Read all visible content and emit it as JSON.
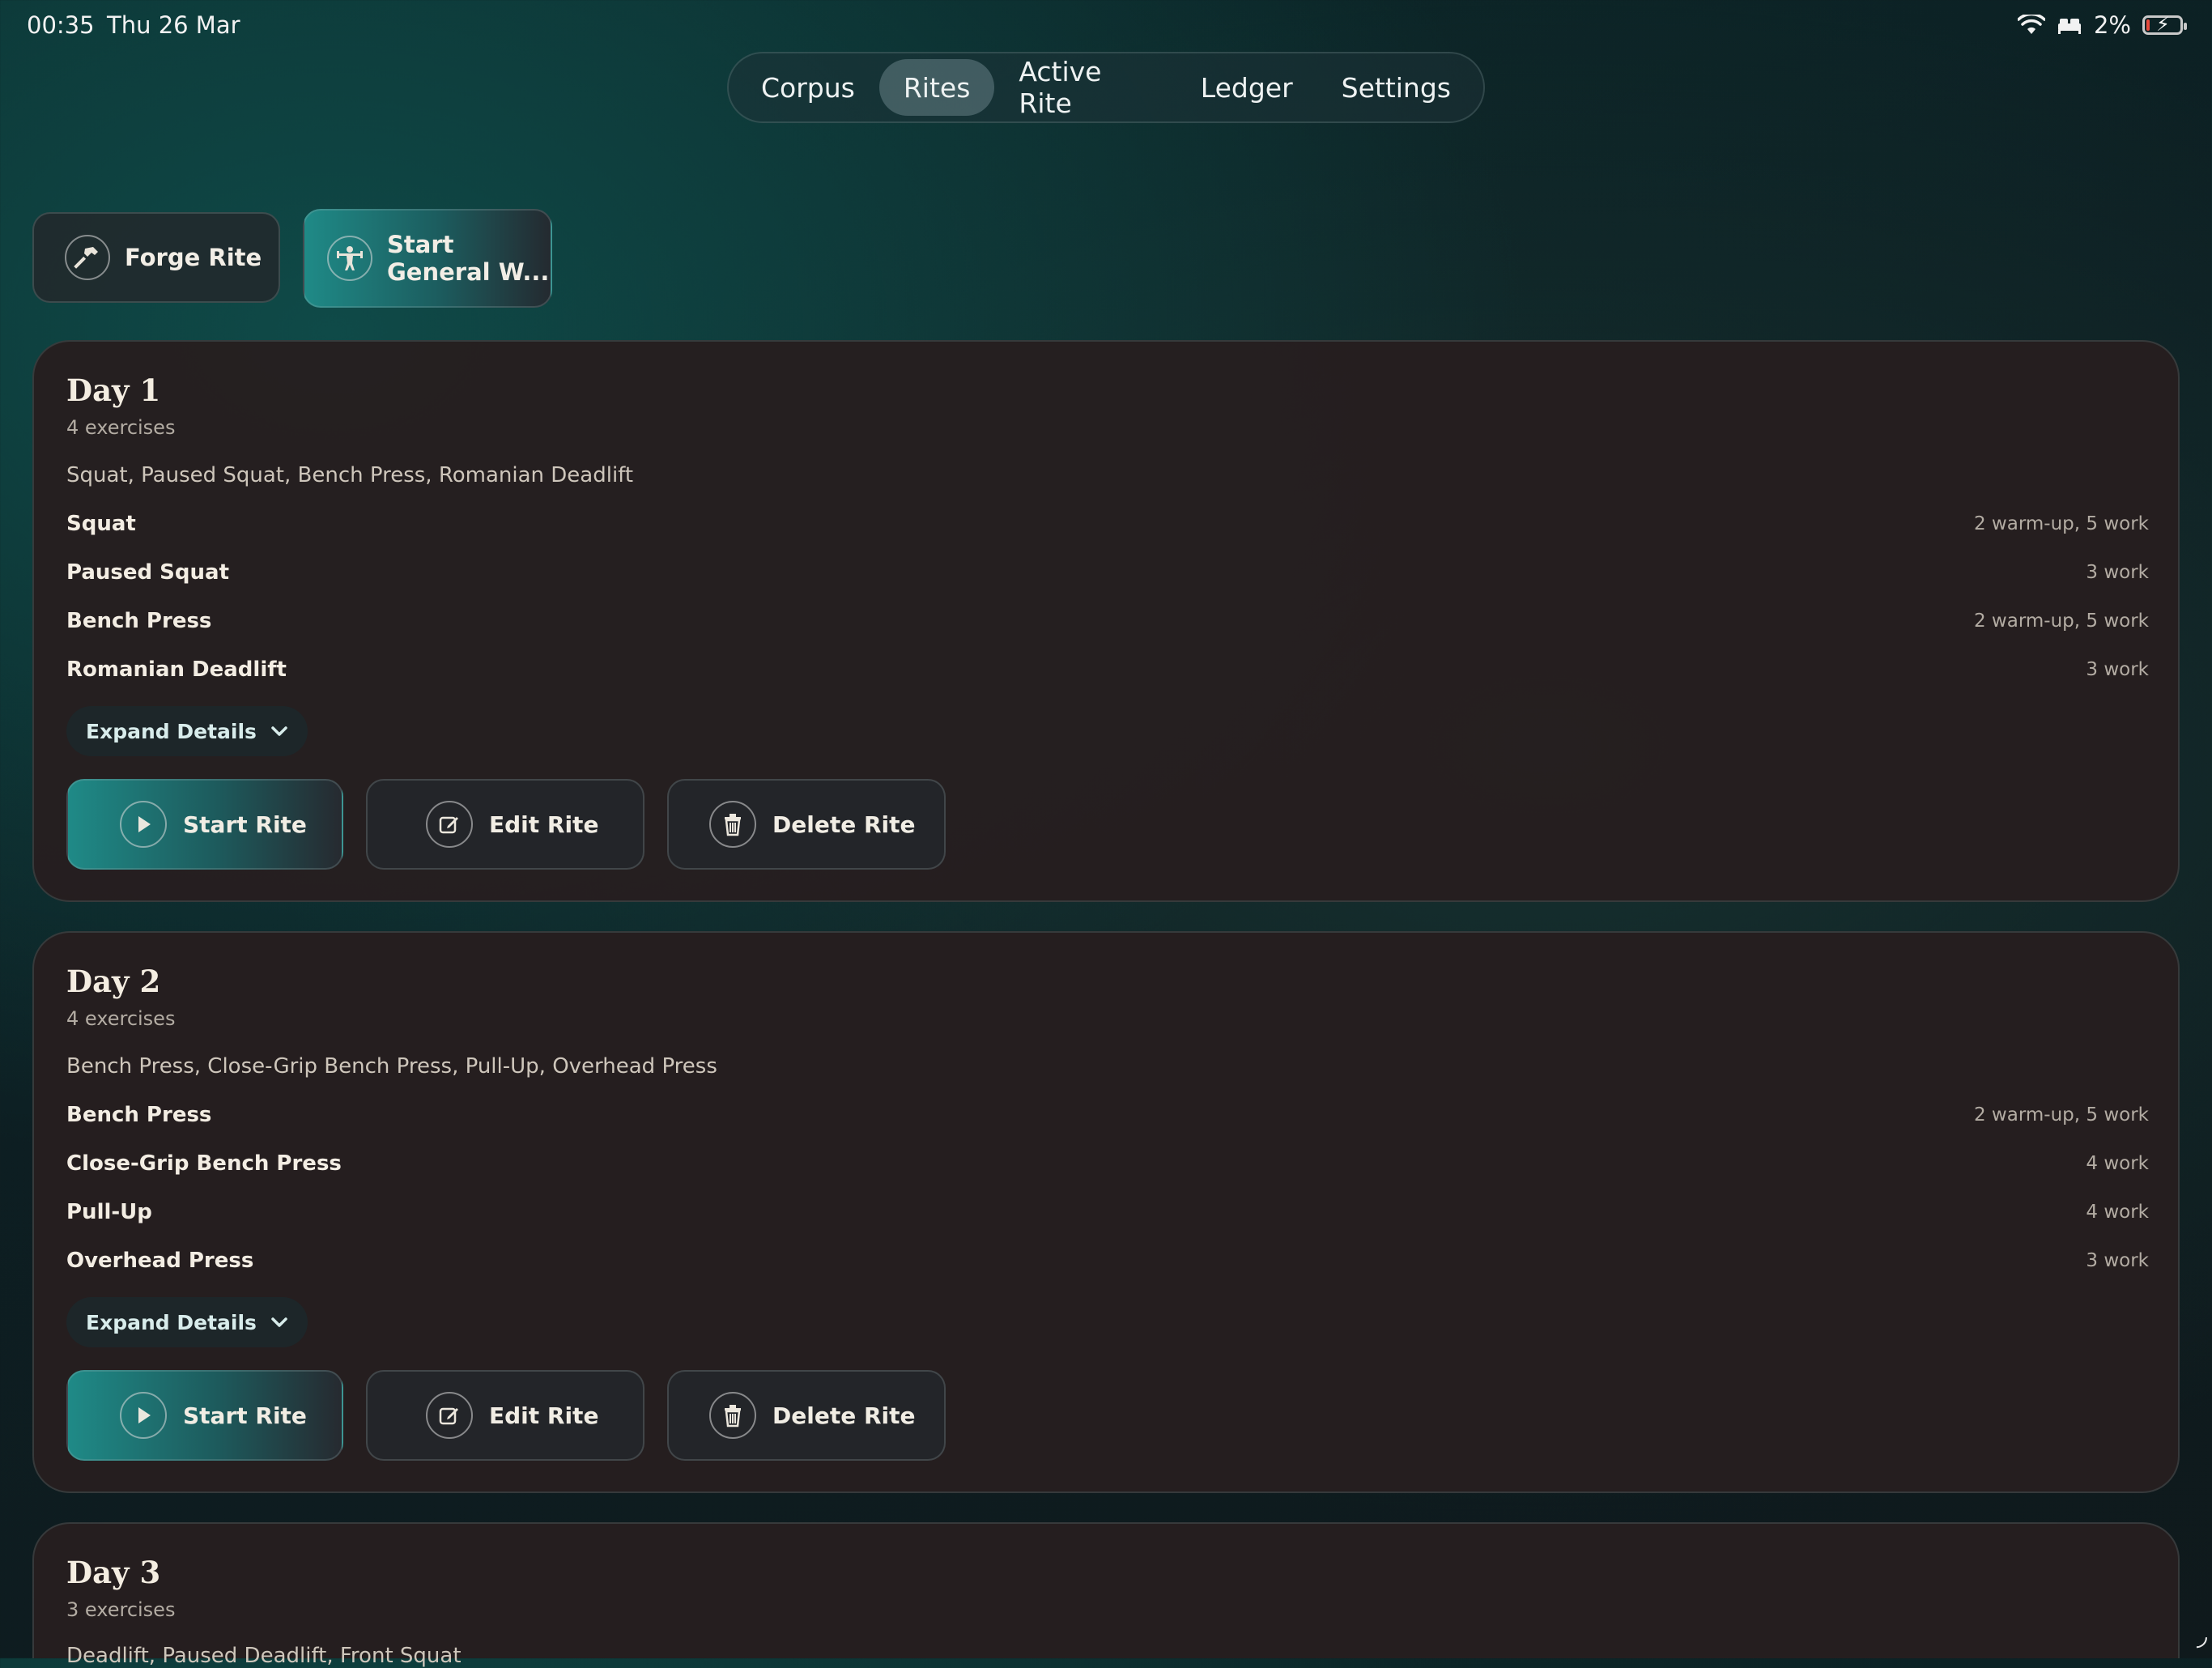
{
  "status_bar": {
    "time": "00:35",
    "date": "Thu 26 Mar",
    "battery": "2%",
    "icons": [
      "wifi-icon",
      "bed-icon",
      "battery-charging-icon"
    ]
  },
  "nav": {
    "tabs": [
      {
        "label": "Corpus",
        "active": false
      },
      {
        "label": "Rites",
        "active": true
      },
      {
        "label": "Active Rite",
        "active": false
      },
      {
        "label": "Ledger",
        "active": false
      },
      {
        "label": "Settings",
        "active": false
      }
    ]
  },
  "actions": {
    "forge_label": "Forge Rite",
    "general_line1": "Start",
    "general_line2": "General W..."
  },
  "card_actions": {
    "expand_label": "Expand Details",
    "start_label": "Start Rite",
    "edit_label": "Edit Rite",
    "delete_label": "Delete Rite"
  },
  "days": [
    {
      "title": "Day 1",
      "count": "4 exercises",
      "summary": "Squat, Paused Squat, Bench Press, Romanian Deadlift",
      "exercises": [
        {
          "name": "Squat",
          "sets": "2 warm-up, 5 work"
        },
        {
          "name": "Paused Squat",
          "sets": "3 work"
        },
        {
          "name": "Bench Press",
          "sets": "2 warm-up, 5 work"
        },
        {
          "name": "Romanian Deadlift",
          "sets": "3 work"
        }
      ]
    },
    {
      "title": "Day 2",
      "count": "4 exercises",
      "summary": "Bench Press, Close-Grip Bench Press, Pull-Up, Overhead Press",
      "exercises": [
        {
          "name": "Bench Press",
          "sets": "2 warm-up, 5 work"
        },
        {
          "name": "Close-Grip Bench Press",
          "sets": "4 work"
        },
        {
          "name": "Pull-Up",
          "sets": "4 work"
        },
        {
          "name": "Overhead Press",
          "sets": "3 work"
        }
      ]
    },
    {
      "title": "Day 3",
      "count": "3 exercises",
      "summary": "Deadlift, Paused Deadlift, Front Squat"
    }
  ],
  "colors": {
    "accent": "#1f8a87",
    "card_bg": "#261e1f",
    "background": "#0d1e22"
  }
}
